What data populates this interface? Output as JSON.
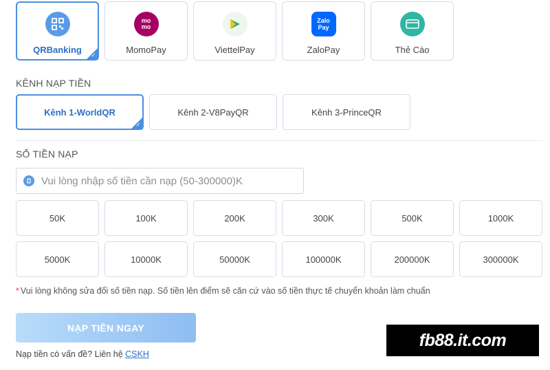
{
  "payment_methods": [
    {
      "label": "QRBanking",
      "icon": "qr-icon",
      "active": true,
      "color": "#5a9be8"
    },
    {
      "label": "MomoPay",
      "icon": "momo-icon",
      "active": false,
      "color": "#a50064",
      "icon_text": "mo mo"
    },
    {
      "label": "ViettelPay",
      "icon": "viettelpay-icon",
      "active": false,
      "color": "#3aa55a"
    },
    {
      "label": "ZaloPay",
      "icon": "zalopay-icon",
      "active": false,
      "color": "#0068ff",
      "icon_text": "Zalo Pay"
    },
    {
      "label": "Thẻ Cào",
      "icon": "card-icon",
      "active": false,
      "color": "#2fb6a4"
    }
  ],
  "channel_section": {
    "title": "KÊNH NẠP TIỀN"
  },
  "channels": [
    {
      "label": "Kênh 1-WorldQR",
      "active": true
    },
    {
      "label": "Kênh 2-V8PayQR",
      "active": false
    },
    {
      "label": "Kênh 3-PrinceQR",
      "active": false
    }
  ],
  "amount_section": {
    "title": "SỐ TIỀN NẠP",
    "placeholder": "Vui lòng nhập số tiền cần nạp (50-300000)K",
    "value": ""
  },
  "amounts": [
    "50K",
    "100K",
    "200K",
    "300K",
    "500K",
    "1000K",
    "5000K",
    "10000K",
    "50000K",
    "100000K",
    "200000K",
    "300000K"
  ],
  "note": {
    "star": "*",
    "text": "Vui lòng không sửa đổi số tiền nạp. Số tiền lên điểm sẽ căn cứ vào số tiền thực tế chuyển khoản làm chuẩn"
  },
  "submit": {
    "label": "NẠP TIỀN NGAY"
  },
  "help": {
    "text": "Nạp tiền có vấn đề? Liên hệ",
    "link": "CSKH"
  },
  "watermark": {
    "text": "fb88.it.com"
  },
  "accent_color": "#4a8fe0"
}
